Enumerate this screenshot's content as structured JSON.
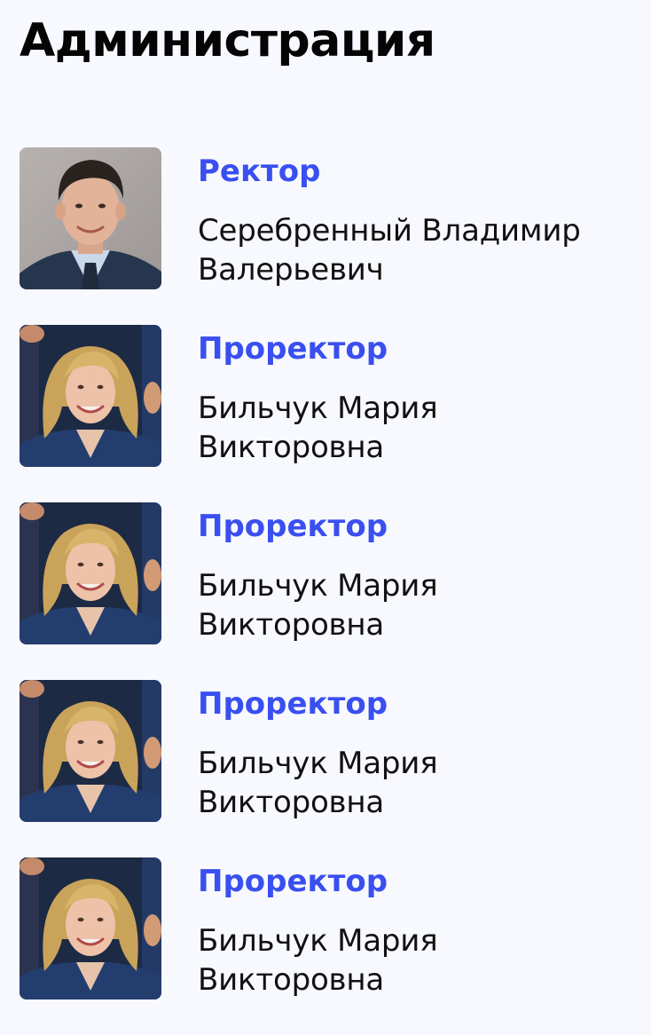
{
  "page": {
    "title": "Администрация"
  },
  "staff": [
    {
      "role": "Ректор",
      "name": "Серебренный Владимир Валерьевич"
    },
    {
      "role": "Проректор",
      "name": "Бильчук Мария Викторовна"
    },
    {
      "role": "Проректор",
      "name": "Бильчук Мария Викторовна"
    },
    {
      "role": "Проректор",
      "name": "Бильчук Мария Викторовна"
    },
    {
      "role": "Проректор",
      "name": "Бильчук Мария Викторовна"
    }
  ],
  "colors": {
    "background": "#f7f9fe",
    "role_accent": "#3a4ff0",
    "text": "#111111"
  }
}
